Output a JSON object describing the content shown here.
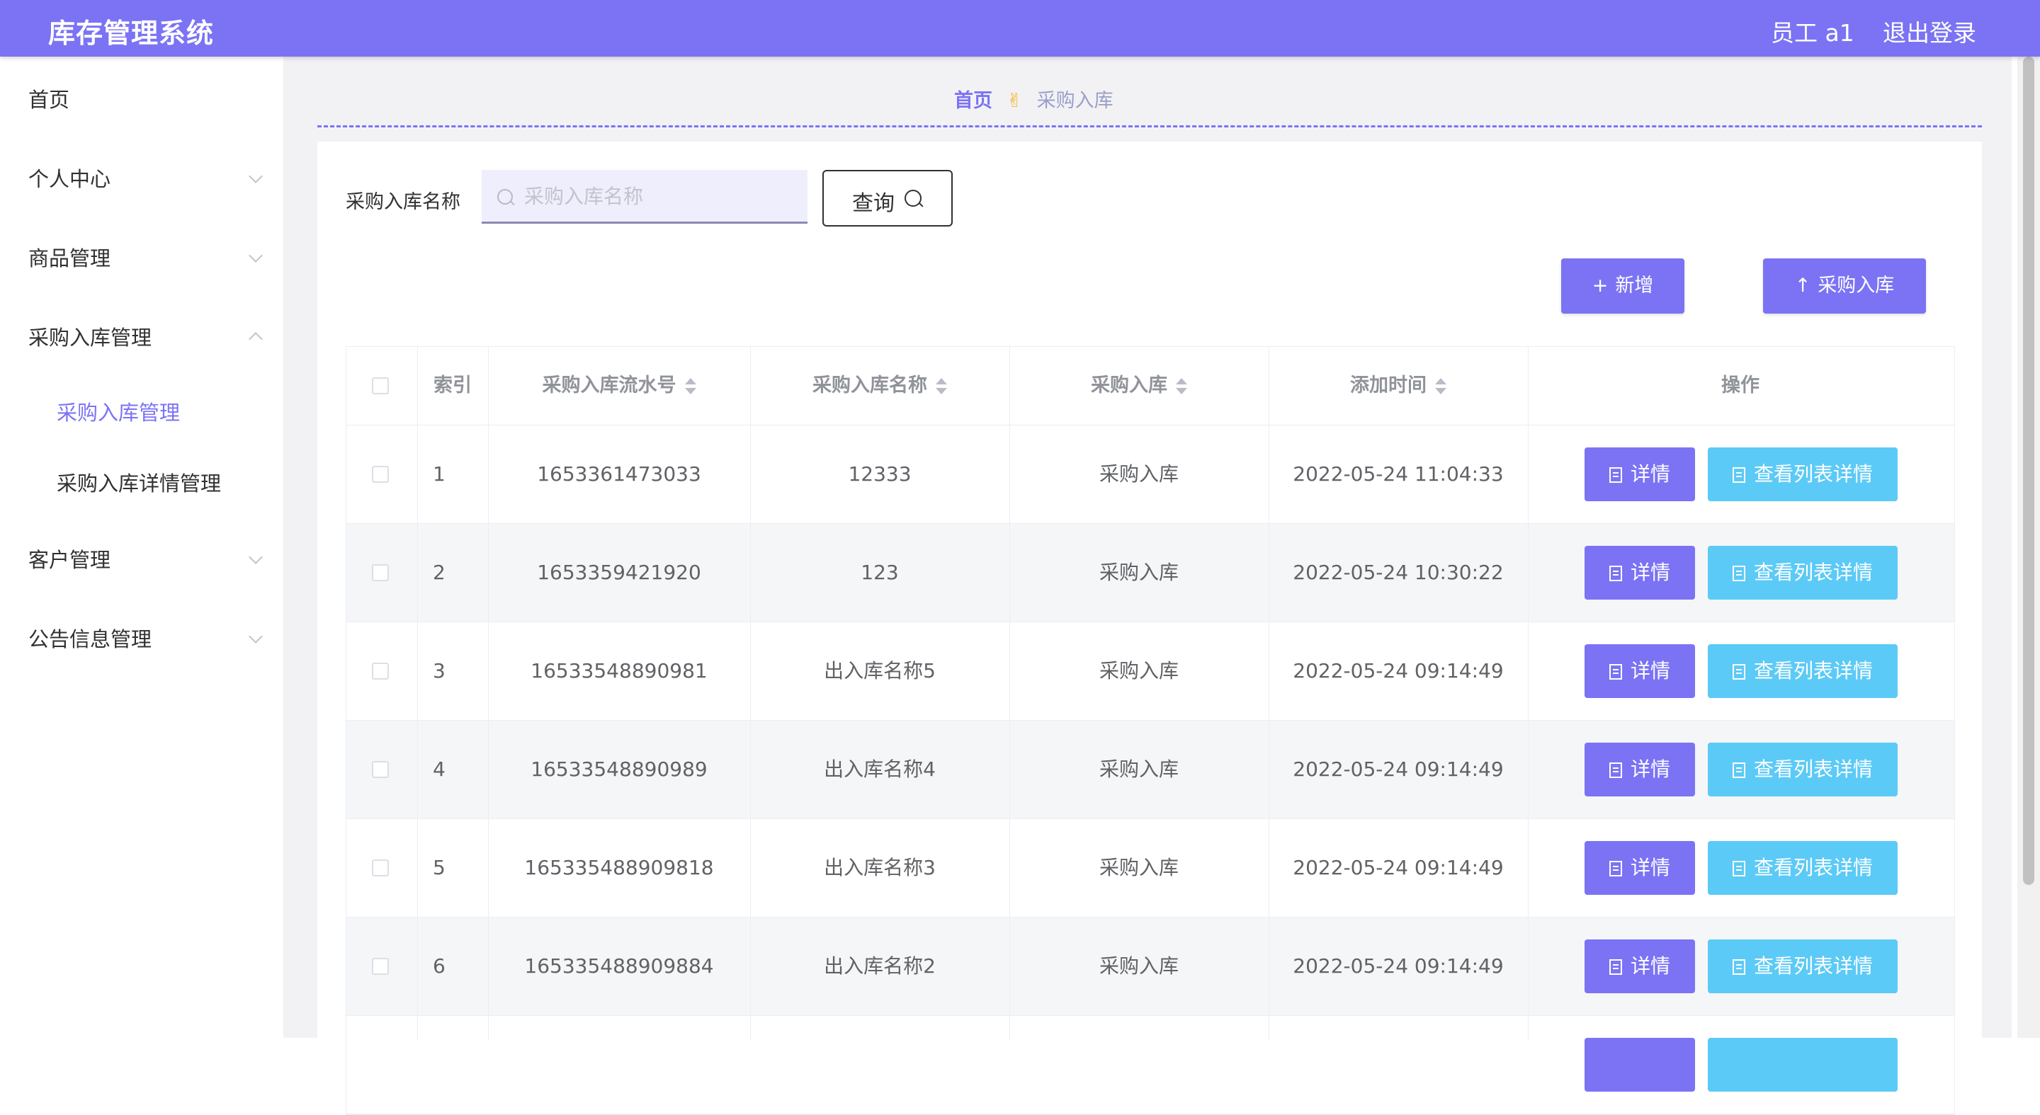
{
  "app": {
    "title": "库存管理系统"
  },
  "header": {
    "user": "员工 a1",
    "logout": "退出登录"
  },
  "sidebar": {
    "items": [
      {
        "label": "首页"
      },
      {
        "label": "个人中心"
      },
      {
        "label": "商品管理"
      },
      {
        "label": "采购入库管理"
      },
      {
        "label": "客户管理"
      },
      {
        "label": "公告信息管理"
      }
    ],
    "submenu": [
      {
        "label": "采购入库管理"
      },
      {
        "label": "采购入库详情管理"
      }
    ]
  },
  "breadcrumb": {
    "home": "首页",
    "separator": "✌",
    "current": "采购入库"
  },
  "search": {
    "label": "采购入库名称",
    "placeholder": "采购入库名称",
    "value": "",
    "button": "查询"
  },
  "actions": {
    "add": "新增",
    "import": "采购入库"
  },
  "table": {
    "headers": [
      "索引",
      "采购入库流水号",
      "采购入库名称",
      "采购入库",
      "添加时间",
      "操作"
    ],
    "detail_label": "详情",
    "list_detail_label": "查看列表详情",
    "rows": [
      {
        "index": "1",
        "serial": "1653361473033",
        "name": "12333",
        "type": "采购入库",
        "time": "2022-05-24 11:04:33"
      },
      {
        "index": "2",
        "serial": "1653359421920",
        "name": "123",
        "type": "采购入库",
        "time": "2022-05-24 10:30:22"
      },
      {
        "index": "3",
        "serial": "16533548890981",
        "name": "出入库名称5",
        "type": "采购入库",
        "time": "2022-05-24 09:14:49"
      },
      {
        "index": "4",
        "serial": "16533548890989",
        "name": "出入库名称4",
        "type": "采购入库",
        "time": "2022-05-24 09:14:49"
      },
      {
        "index": "5",
        "serial": "165335488909818",
        "name": "出入库名称3",
        "type": "采购入库",
        "time": "2022-05-24 09:14:49"
      },
      {
        "index": "6",
        "serial": "165335488909884",
        "name": "出入库名称2",
        "type": "采购入库",
        "time": "2022-05-24 09:14:49"
      }
    ]
  },
  "colors": {
    "primary": "#7b73f4",
    "info": "#5ccaf6",
    "accent": "#f3b41d"
  }
}
